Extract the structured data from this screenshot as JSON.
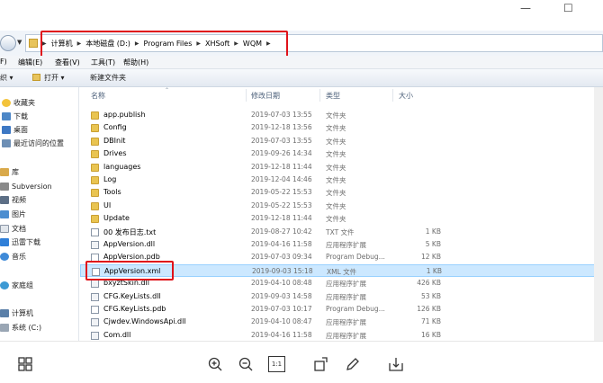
{
  "window": {
    "minimize_glyph": "—",
    "maximize_glyph": "☐",
    "close_glyph": "✕"
  },
  "address": {
    "crumbs": [
      "计算机",
      "本地磁盘 (D:)",
      "Program Files",
      "XHSoft",
      "WQM"
    ]
  },
  "menu": {
    "items": [
      "F)",
      "编辑(E)",
      "查看(V)",
      "工具(T)",
      "帮助(H)"
    ]
  },
  "toolbar": {
    "organize_label": "织",
    "open_label": "打开",
    "new_folder_label": "新建文件夹"
  },
  "nav": {
    "items": [
      {
        "label": "收藏夹",
        "icon": "star-icon"
      },
      {
        "label": "下载",
        "icon": "download-folder-icon"
      },
      {
        "label": "桌面",
        "icon": "desktop-icon"
      },
      {
        "label": "最近访问的位置",
        "icon": "recent-places-icon"
      },
      {
        "label": "库",
        "icon": "library-icon"
      },
      {
        "label": "Subversion",
        "icon": "subversion-icon"
      },
      {
        "label": "视频",
        "icon": "video-library-icon"
      },
      {
        "label": "图片",
        "icon": "picture-library-icon"
      },
      {
        "label": "文档",
        "icon": "document-library-icon"
      },
      {
        "label": "迅雷下载",
        "icon": "thunder-download-icon"
      },
      {
        "label": "音乐",
        "icon": "music-library-icon"
      },
      {
        "label": "家庭组",
        "icon": "homegroup-icon"
      },
      {
        "label": "计算机",
        "icon": "computer-icon"
      },
      {
        "label": "系统 (C:)",
        "icon": "drive-icon"
      }
    ]
  },
  "columns": {
    "name": "名称",
    "date": "修改日期",
    "type": "类型",
    "size": "大小"
  },
  "files": [
    {
      "name": "app.publish",
      "date": "2019-07-03 13:55",
      "type": "文件夹",
      "size": "",
      "kind": "folder"
    },
    {
      "name": "Config",
      "date": "2019-12-18 13:56",
      "type": "文件夹",
      "size": "",
      "kind": "folder"
    },
    {
      "name": "DBInit",
      "date": "2019-07-03 13:55",
      "type": "文件夹",
      "size": "",
      "kind": "folder"
    },
    {
      "name": "Drives",
      "date": "2019-09-26 14:34",
      "type": "文件夹",
      "size": "",
      "kind": "folder"
    },
    {
      "name": "languages",
      "date": "2019-12-18 11:44",
      "type": "文件夹",
      "size": "",
      "kind": "folder"
    },
    {
      "name": "Log",
      "date": "2019-12-04 14:46",
      "type": "文件夹",
      "size": "",
      "kind": "folder"
    },
    {
      "name": "Tools",
      "date": "2019-05-22 15:53",
      "type": "文件夹",
      "size": "",
      "kind": "folder"
    },
    {
      "name": "UI",
      "date": "2019-05-22 15:53",
      "type": "文件夹",
      "size": "",
      "kind": "folder"
    },
    {
      "name": "Update",
      "date": "2019-12-18 11:44",
      "type": "文件夹",
      "size": "",
      "kind": "folder"
    },
    {
      "name": "00 发布日志.txt",
      "date": "2019-08-27 10:42",
      "type": "TXT 文件",
      "size": "1 KB",
      "kind": "file"
    },
    {
      "name": "AppVersion.dll",
      "date": "2019-04-16 11:58",
      "type": "应用程序扩展",
      "size": "5 KB",
      "kind": "dll"
    },
    {
      "name": "AppVersion.pdb",
      "date": "2019-07-03 09:34",
      "type": "Program Debug...",
      "size": "12 KB",
      "kind": "file"
    },
    {
      "name": "AppVersion.xml",
      "date": "2019-09-03 15:18",
      "type": "XML 文件",
      "size": "1 KB",
      "kind": "file",
      "selected": true
    },
    {
      "name": "bxyztSkin.dll",
      "date": "2019-04-10 08:48",
      "type": "应用程序扩展",
      "size": "426 KB",
      "kind": "dll"
    },
    {
      "name": "CFG.KeyLists.dll",
      "date": "2019-09-03 14:58",
      "type": "应用程序扩展",
      "size": "53 KB",
      "kind": "dll"
    },
    {
      "name": "CFG.KeyLists.pdb",
      "date": "2019-07-03 10:17",
      "type": "Program Debug...",
      "size": "126 KB",
      "kind": "file"
    },
    {
      "name": "Cjwdev.WindowsApi.dll",
      "date": "2019-04-10 08:47",
      "type": "应用程序扩展",
      "size": "71 KB",
      "kind": "dll"
    },
    {
      "name": "Com.dll",
      "date": "2019-04-16 11:58",
      "type": "应用程序扩展",
      "size": "16 KB",
      "kind": "dll"
    }
  ],
  "viewer_toolbar": {
    "actual_size_label": "1:1"
  },
  "colors": {
    "highlight_red": "#e0121a",
    "selection_bg": "#cce8ff",
    "folder_yellow": "#e9c451"
  }
}
